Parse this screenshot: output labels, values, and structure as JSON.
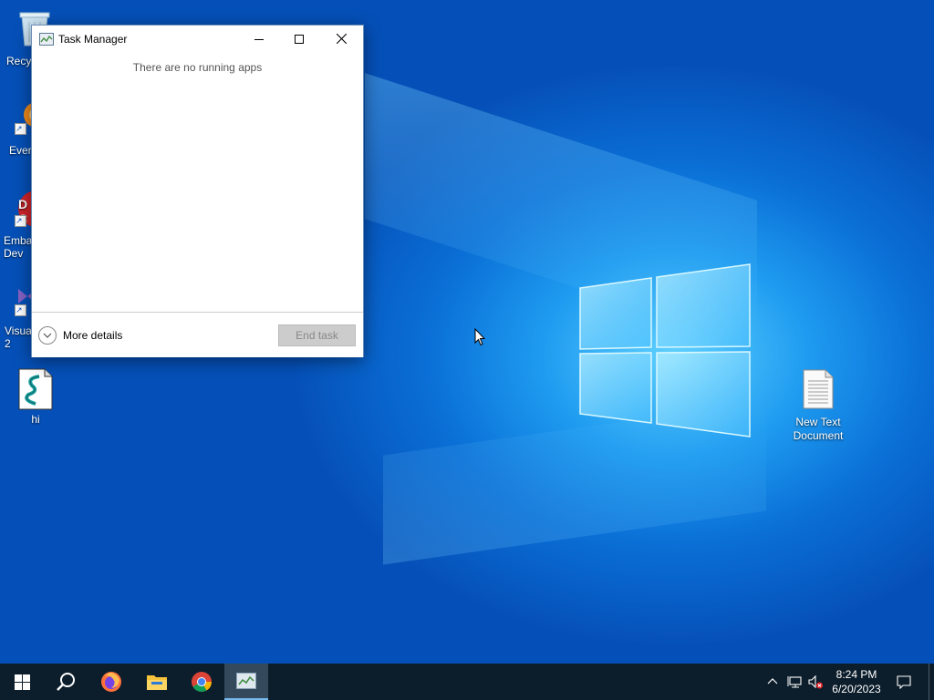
{
  "desktop": {
    "icons": [
      {
        "id": "recycle",
        "label": "Recy"
      },
      {
        "id": "everything",
        "label": "Ever"
      },
      {
        "id": "embarcadero",
        "label": "Emba\nDev"
      },
      {
        "id": "visualstudio",
        "label": "Visua\n2"
      },
      {
        "id": "hi",
        "label": "hi"
      },
      {
        "id": "newtext",
        "label": "New Text\nDocument"
      }
    ]
  },
  "task_manager": {
    "title": "Task Manager",
    "empty_message": "There are no running apps",
    "more_details_label": "More details",
    "end_task_label": "End task"
  },
  "taskbar": {
    "items": [
      "start-button",
      "search-button",
      "firefox",
      "file-explorer",
      "chrome",
      "task-manager"
    ],
    "active_item": "task-manager",
    "clock_time": "8:24 PM",
    "clock_date": "6/20/2023"
  },
  "colors": {
    "accent": "#0078d7",
    "taskbar": "#0c1d2b",
    "desktop": "#0a6fd6"
  }
}
